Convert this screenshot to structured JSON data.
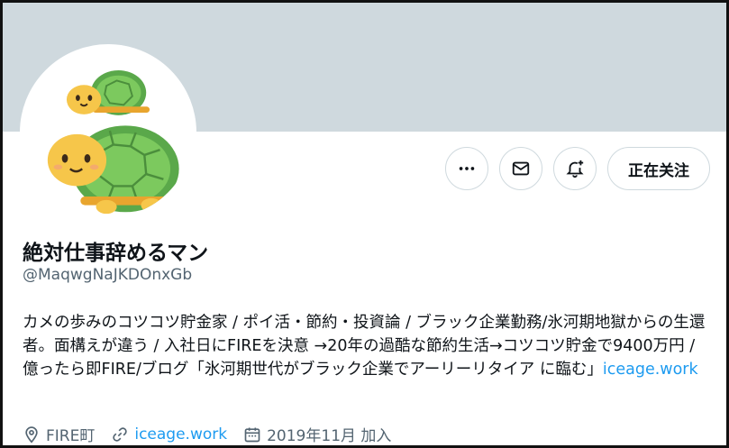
{
  "header": {
    "banner_color": "#cfd9de",
    "avatar_icon": "turtle-avatar"
  },
  "actions": {
    "more_icon": "more-dots-icon",
    "message_icon": "mail-icon",
    "notify_icon": "bell-plus-icon",
    "follow_label": "正在关注"
  },
  "profile": {
    "name": "絶対仕事辞めるマン",
    "handle": "@MaqwgNaJKDOnxGb",
    "bio_text": "カメの歩みのコツコツ貯金家 / ポイ活・節約・投資論 / ブラック企業勤務/氷河期地獄からの生還者。面構えが違う / 入社日にFIREを決意 →20年の過酷な節約生活→コツコツ貯金で9400万円 / 億ったら即FIRE/ブログ「氷河期世代がブラック企業でアーリーリタイア に臨む」",
    "bio_link": "iceage.work"
  },
  "meta": {
    "location": "FIRE町",
    "website": "iceage.work",
    "joined": "2019年11月 加入"
  },
  "colors": {
    "accent": "#1d9bf0",
    "secondary_text": "#536471",
    "border": "#cfd9de"
  }
}
